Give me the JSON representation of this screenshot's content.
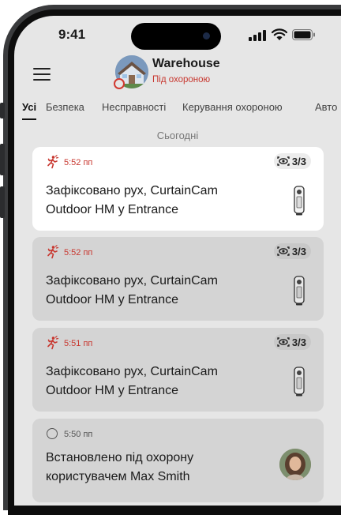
{
  "status_bar": {
    "time": "9:41"
  },
  "header": {
    "hub_name": "Warehouse",
    "hub_state": "Під охороною"
  },
  "tabs": [
    {
      "label": "Усі",
      "active": true
    },
    {
      "label": "Безпека",
      "active": false
    },
    {
      "label": "Несправності",
      "active": false
    },
    {
      "label": "Керування охороною",
      "active": false
    },
    {
      "label": "Авто",
      "active": false
    }
  ],
  "section": {
    "title": "Сьогодні"
  },
  "events": [
    {
      "time": "5:52 пп",
      "text": "Зафіксовано рух, CurtainCam Outdoor HM у Entrance",
      "badge": "3/3",
      "type": "motion"
    },
    {
      "time": "5:52 пп",
      "text": "Зафіксовано рух, CurtainCam Outdoor HM у Entrance",
      "badge": "3/3",
      "type": "motion"
    },
    {
      "time": "5:51 пп",
      "text": "Зафіксовано рух, CurtainCam Outdoor HM у Entrance",
      "badge": "3/3",
      "type": "motion"
    },
    {
      "time": "5:50 пп",
      "text": "Встановлено під охорону користувачем Max Smith",
      "type": "arm"
    }
  ],
  "colors": {
    "alarm": "#c8372f",
    "card_active": "#ffffff",
    "card_dim": "#d4d4d4",
    "screen_bg": "#e6e6e6"
  }
}
